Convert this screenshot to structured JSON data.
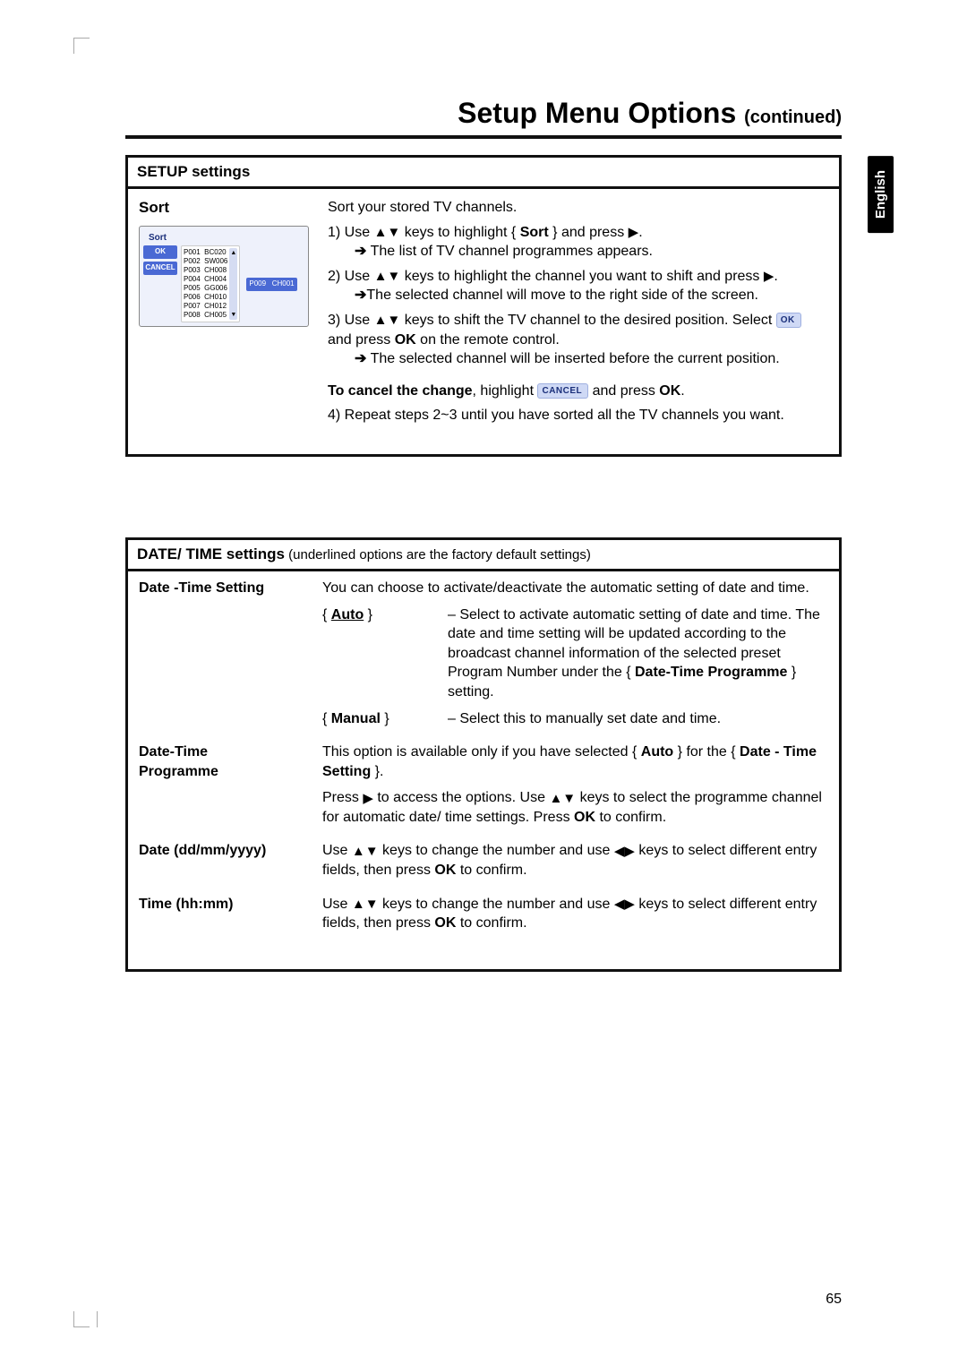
{
  "page": {
    "title_main": "Setup Menu Options",
    "title_cont": "(continued)",
    "lang_tab": "English",
    "page_number": "65"
  },
  "setup_box": {
    "heading": "SETUP settings",
    "item_title": "Sort",
    "osd": {
      "title": "Sort",
      "ok": "OK",
      "cancel": "CANCEL",
      "channels": [
        "P001  BC020",
        "P002  SW006",
        "P003  CH008",
        "P004  CH004",
        "P005  GG006",
        "P006  CH010",
        "P007  CH012",
        "P008  CH005"
      ],
      "selected": "P009   CH001"
    },
    "p_intro": "Sort your stored TV channels.",
    "s1a": "1) Use ",
    "s1b": " keys to highlight { ",
    "s1c": "Sort",
    "s1d": " } and press ",
    "s1e": ".",
    "s1_res": " The list of TV channel programmes appears.",
    "s2a": "2) Use ",
    "s2b": " keys to highlight the channel you want to shift and press ",
    "s2c": ".",
    "s2_res": "The selected channel will move to the right side of the screen.",
    "s3a": "3) Use ",
    "s3b": " keys to shift the TV channel to the desired position. Select ",
    "s3_pill": "OK",
    "s3c": " and press ",
    "s3_ok": "OK",
    "s3d": " on the remote control.",
    "s3_res": " The selected channel will be inserted before the current position.",
    "cancel_a": "To cancel the change",
    "cancel_b": ", highlight ",
    "cancel_pill": "CANCEL",
    "cancel_c": " and press ",
    "cancel_ok": "OK",
    "cancel_d": ".",
    "s4": "4) Repeat steps 2~3 until you have sorted all the TV channels you want."
  },
  "dt_box": {
    "heading_a": "DATE/ TIME settings",
    "heading_b": " (underlined options are the factory default settings)",
    "r1_title": "Date -Time Setting",
    "r1_desc": "You can choose to activate/deactivate the automatic setting of date and time.",
    "r1_auto_key": "Auto",
    "r1_auto_val_a": "– Select to activate automatic setting of date and time. The date and time setting will be updated according to the broadcast channel information of the selected preset Program Number under the { ",
    "r1_auto_val_b": "Date-Time Programme",
    "r1_auto_val_c": " } setting.",
    "r1_manual_key": "Manual",
    "r1_manual_val": "– Select this to manually set date and time.",
    "r2_title_a": "Date-Time",
    "r2_title_b": "Programme",
    "r2_desc_a": "This option is available only if you have selected { ",
    "r2_desc_b": "Auto",
    "r2_desc_c": " } for the { ",
    "r2_desc_d": "Date - Time Setting",
    "r2_desc_e": " }.",
    "r2_p2_a": "Press ",
    "r2_p2_b": " to access the options. Use ",
    "r2_p2_c": " keys to select the programme channel for automatic date/ time settings. Press ",
    "r2_p2_ok": "OK",
    "r2_p2_d": " to confirm.",
    "r3_title": "Date (dd/mm/yyyy)",
    "r3_desc_a": "Use ",
    "r3_desc_b": " keys to change the number and use ",
    "r3_desc_c": " keys to select different entry fields, then press ",
    "r3_desc_ok": "OK",
    "r3_desc_d": " to confirm.",
    "r4_title": "Time (hh:mm)",
    "r4_desc_a": "Use ",
    "r4_desc_b": " keys to change the number and use ",
    "r4_desc_c": " keys to select different entry fields, then press ",
    "r4_desc_ok": "OK",
    "r4_desc_d": " to confirm."
  }
}
